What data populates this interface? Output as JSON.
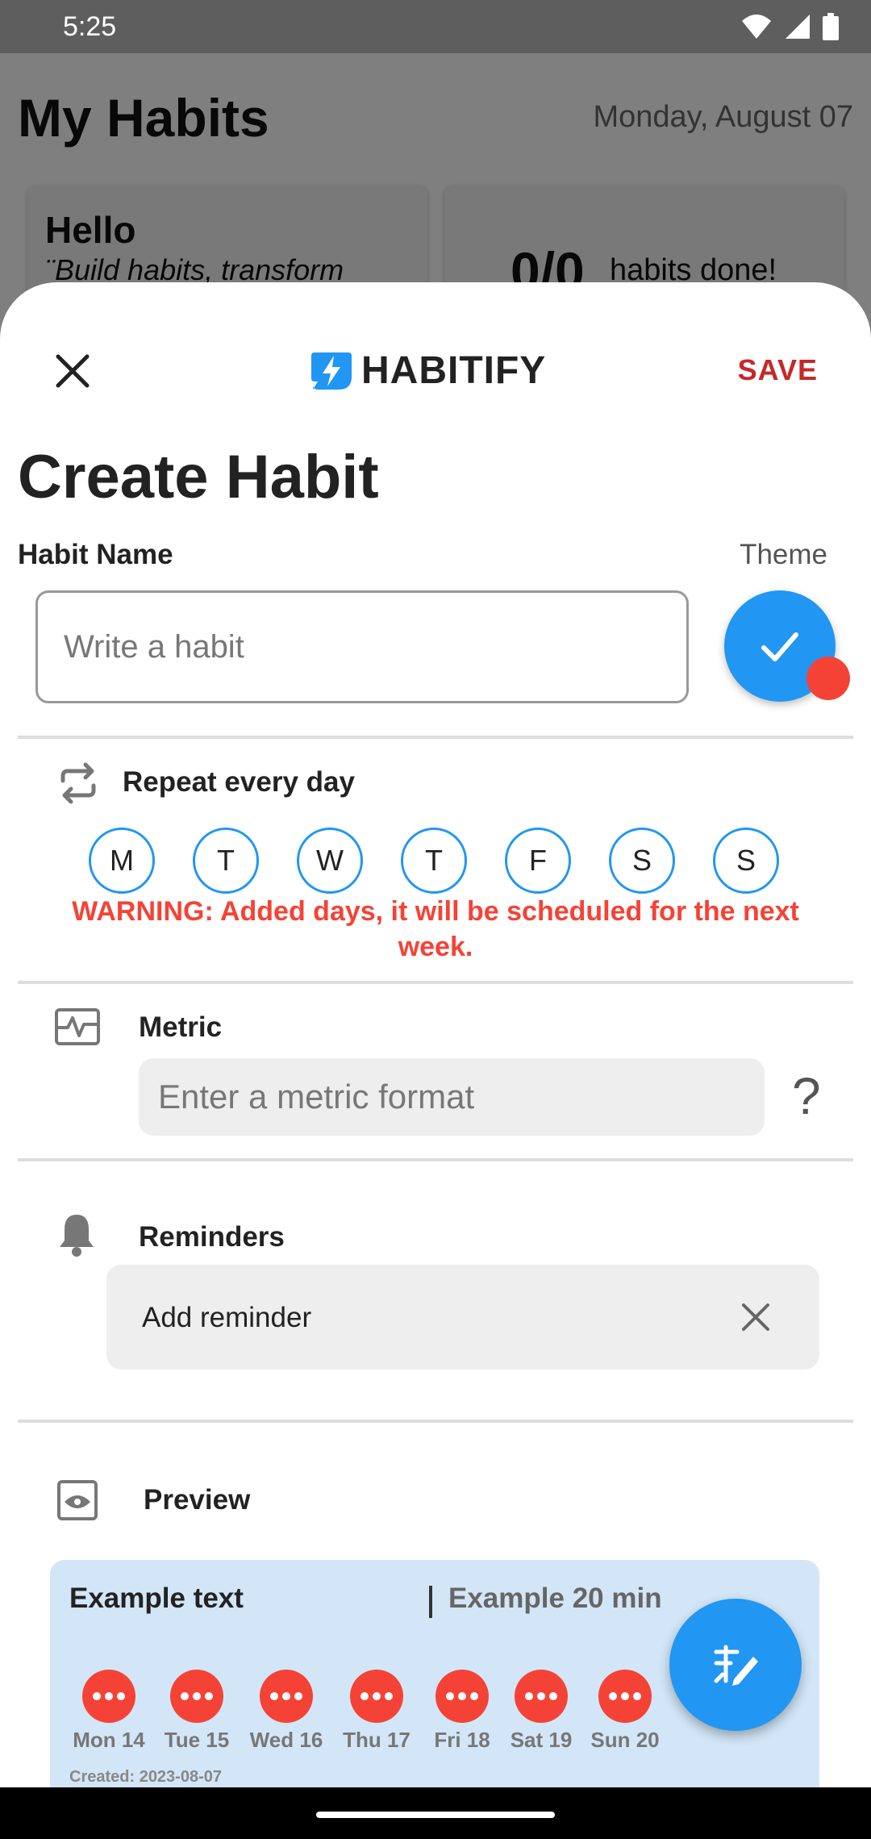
{
  "status_bar": {
    "time": "5:25"
  },
  "background_app": {
    "title": "My Habits",
    "date": "Monday, August 07",
    "greeting": "Hello",
    "quote": "¨Build habits, transform",
    "progress_count": "0/0",
    "progress_label": "habits done!"
  },
  "header": {
    "brand_name": "HABITIFY",
    "save_label": "SAVE"
  },
  "form": {
    "title": "Create Habit",
    "habit_name_label": "Habit Name",
    "habit_name_placeholder": "Write a habit",
    "theme_label": "Theme",
    "theme_color": "#2196f3",
    "theme_badge_color": "#f44336"
  },
  "repeat": {
    "label": "Repeat every day",
    "days": [
      "M",
      "T",
      "W",
      "T",
      "F",
      "S",
      "S"
    ],
    "warning": "WARNING: Added days, it will be scheduled for the next week."
  },
  "metric": {
    "label": "Metric",
    "placeholder": "Enter a metric format",
    "help": "?"
  },
  "reminders": {
    "label": "Reminders",
    "item_label": "Add reminder"
  },
  "preview": {
    "label": "Preview",
    "habit_text": "Example text",
    "duration_text": "Example 20 min",
    "days": [
      "Mon 14",
      "Tue 15",
      "Wed 16",
      "Thu 17",
      "Fri 18",
      "Sat 19",
      "Sun 20"
    ],
    "created": "Created: 2023-08-07"
  },
  "colors": {
    "accent": "#2196f3",
    "danger": "#f44336",
    "save": "#c62828"
  }
}
